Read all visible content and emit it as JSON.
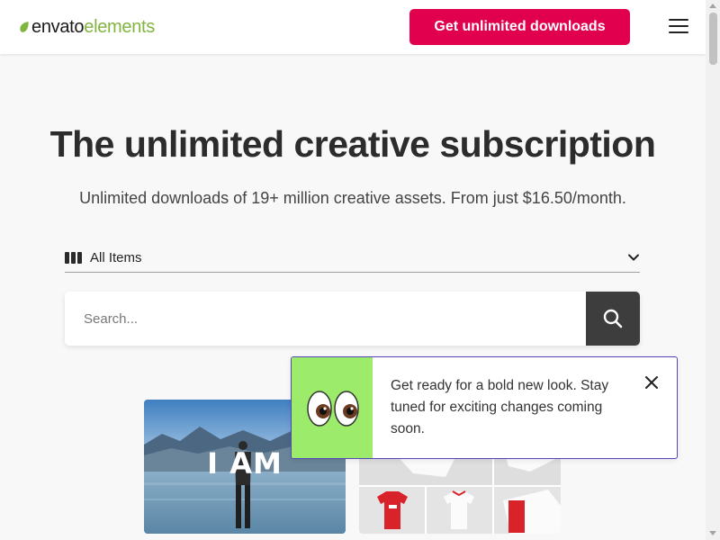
{
  "header": {
    "logo_part1": "envato",
    "logo_part2": "elements",
    "cta_label": "Get unlimited downloads",
    "menu_icon": "hamburger-icon"
  },
  "hero": {
    "title": "The unlimited creative subscription",
    "subtitle": "Unlimited downloads of 19+ million creative assets. From just $16.50/month."
  },
  "search": {
    "category_label": "All Items",
    "category_icon": "grid-icon",
    "placeholder": "Search...",
    "button_icon": "search-icon"
  },
  "thumbnails": [
    {
      "overlay_text": "I AM"
    },
    {
      "product_tag": ""
    }
  ],
  "toast": {
    "message": "Get ready for a bold new look. Stay tuned for exciting changes coming soon.",
    "emoji_icon": "eyes-icon",
    "close_icon": "close-icon"
  },
  "colors": {
    "brand_green": "#82b440",
    "cta_pink": "#e0004d",
    "toast_border": "#5546b9",
    "toast_accent": "#9ceb6a",
    "search_button": "#3d3d3d"
  }
}
